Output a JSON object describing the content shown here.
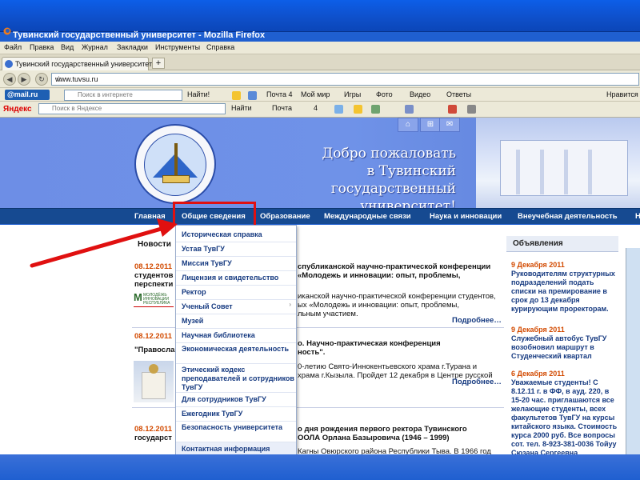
{
  "window": {
    "title": "Тувинский государственный университет - Mozilla Firefox"
  },
  "menubar": [
    "Файл",
    "Правка",
    "Вид",
    "Журнал",
    "Закладки",
    "Инструменты",
    "Справка"
  ],
  "tab": {
    "title": "Тувинский государственный университет",
    "new_tab": "+"
  },
  "nav": {
    "url": "www.tuvsu.ru"
  },
  "mailru_bar": {
    "logo": "@mail.ru",
    "search_placeholder": "Поиск в интернете",
    "find": "Найти!",
    "items": [
      "Почта 4",
      "Мой мир",
      "Игры",
      "Фото",
      "Видео",
      "Ответы"
    ],
    "likes": "Нравится"
  },
  "yandex_bar": {
    "logo": "Яндекс",
    "search_placeholder": "Поиск в Яндексе",
    "find": "Найти",
    "mail": "Почта",
    "count": "4"
  },
  "header": {
    "welcome_line1": "Добро пожаловать",
    "welcome_line2": "в Тувинский государственный",
    "welcome_line3": "университет!"
  },
  "main_nav": [
    "Главная",
    "Общие сведения",
    "Образование",
    "Международные связи",
    "Наука и инновации",
    "Внеучебная деятельность",
    "Н"
  ],
  "dropdown": [
    "Историческая справка",
    "Устав ТувГУ",
    "Миссия ТувГУ",
    "Лицензия и свидетельство",
    "Ректор",
    "Ученый Совет",
    "Музей",
    "Научная библиотека",
    "Экономическая деятельность",
    "Этический кодекс преподавателей и сотрудников ТувГУ",
    "Для сотрудников ТувГУ",
    "Ежегодник ТувГУ",
    "Безопасность университета",
    "Контактная информация"
  ],
  "news": {
    "heading": "Новости",
    "items": [
      {
        "date": "08.12.2011",
        "title_a": "студентов",
        "title_b": "перспекти",
        "title_c": "спубликанской научно-практической конференции",
        "title_d": "«Молодежь и инновации: опыт, проблемы,",
        "body1": "иканской научно-практической конференции студентов,",
        "body2": "ых «Молодежь и инновации: опыт, проблемы,",
        "body3": "льным участием.",
        "logo": "МОЛОДЁЖЬ ИННОВАЦИИ РЕСПУБЛИКА"
      },
      {
        "date": "08.12.2011",
        "title_a": "\"Правосла",
        "title_c": "о. Научно-практическая конференция",
        "title_d": "ность\".",
        "body1": "0-летию Свято-Иннокентьевского храма г.Турана и",
        "body2": "храма г.Кызыла. Пройдет 12 декабря в Центре русской"
      },
      {
        "date": "08.12.2011",
        "title_a": "государст",
        "title_c": "о дня рождения первого ректора Тувинского",
        "title_d": "ООЛА Орлана Базыровича (1946 – 1999)",
        "body1": "Кагны Овюрского района Республики Тыва. В 1966 год"
      }
    ],
    "more": "Подробнее…"
  },
  "sidebar": {
    "heading": "Объявления",
    "items": [
      {
        "date": "9 Декабря 2011",
        "text": "Руководителям структурных подразделений подать списки на премирование в срок до 13 декабря курирующим проректорам."
      },
      {
        "date": "9 Декабря 2011",
        "text": "Служебный автобус ТувГУ возобновил маршрут в Студенческий квартал"
      },
      {
        "date": "6 Декабря 2011",
        "text": "Уважаемые студенты! С 8.12.11 г. в ФФ, в ауд. 220, в 15-20 час. приглашаются все желающие студенты, всех факультетов ТувГУ на курсы китайского языка. Стоимость курса 2000 руб. Все вопросы сот. тел. 8-923-381-0036 Тойуу Сюзана Сергеевна"
      }
    ]
  },
  "colors": {
    "nav_bg": "#164a91",
    "header_bg": "#6d8ee6",
    "highlight": "#e01010",
    "date": "#d24a00"
  }
}
